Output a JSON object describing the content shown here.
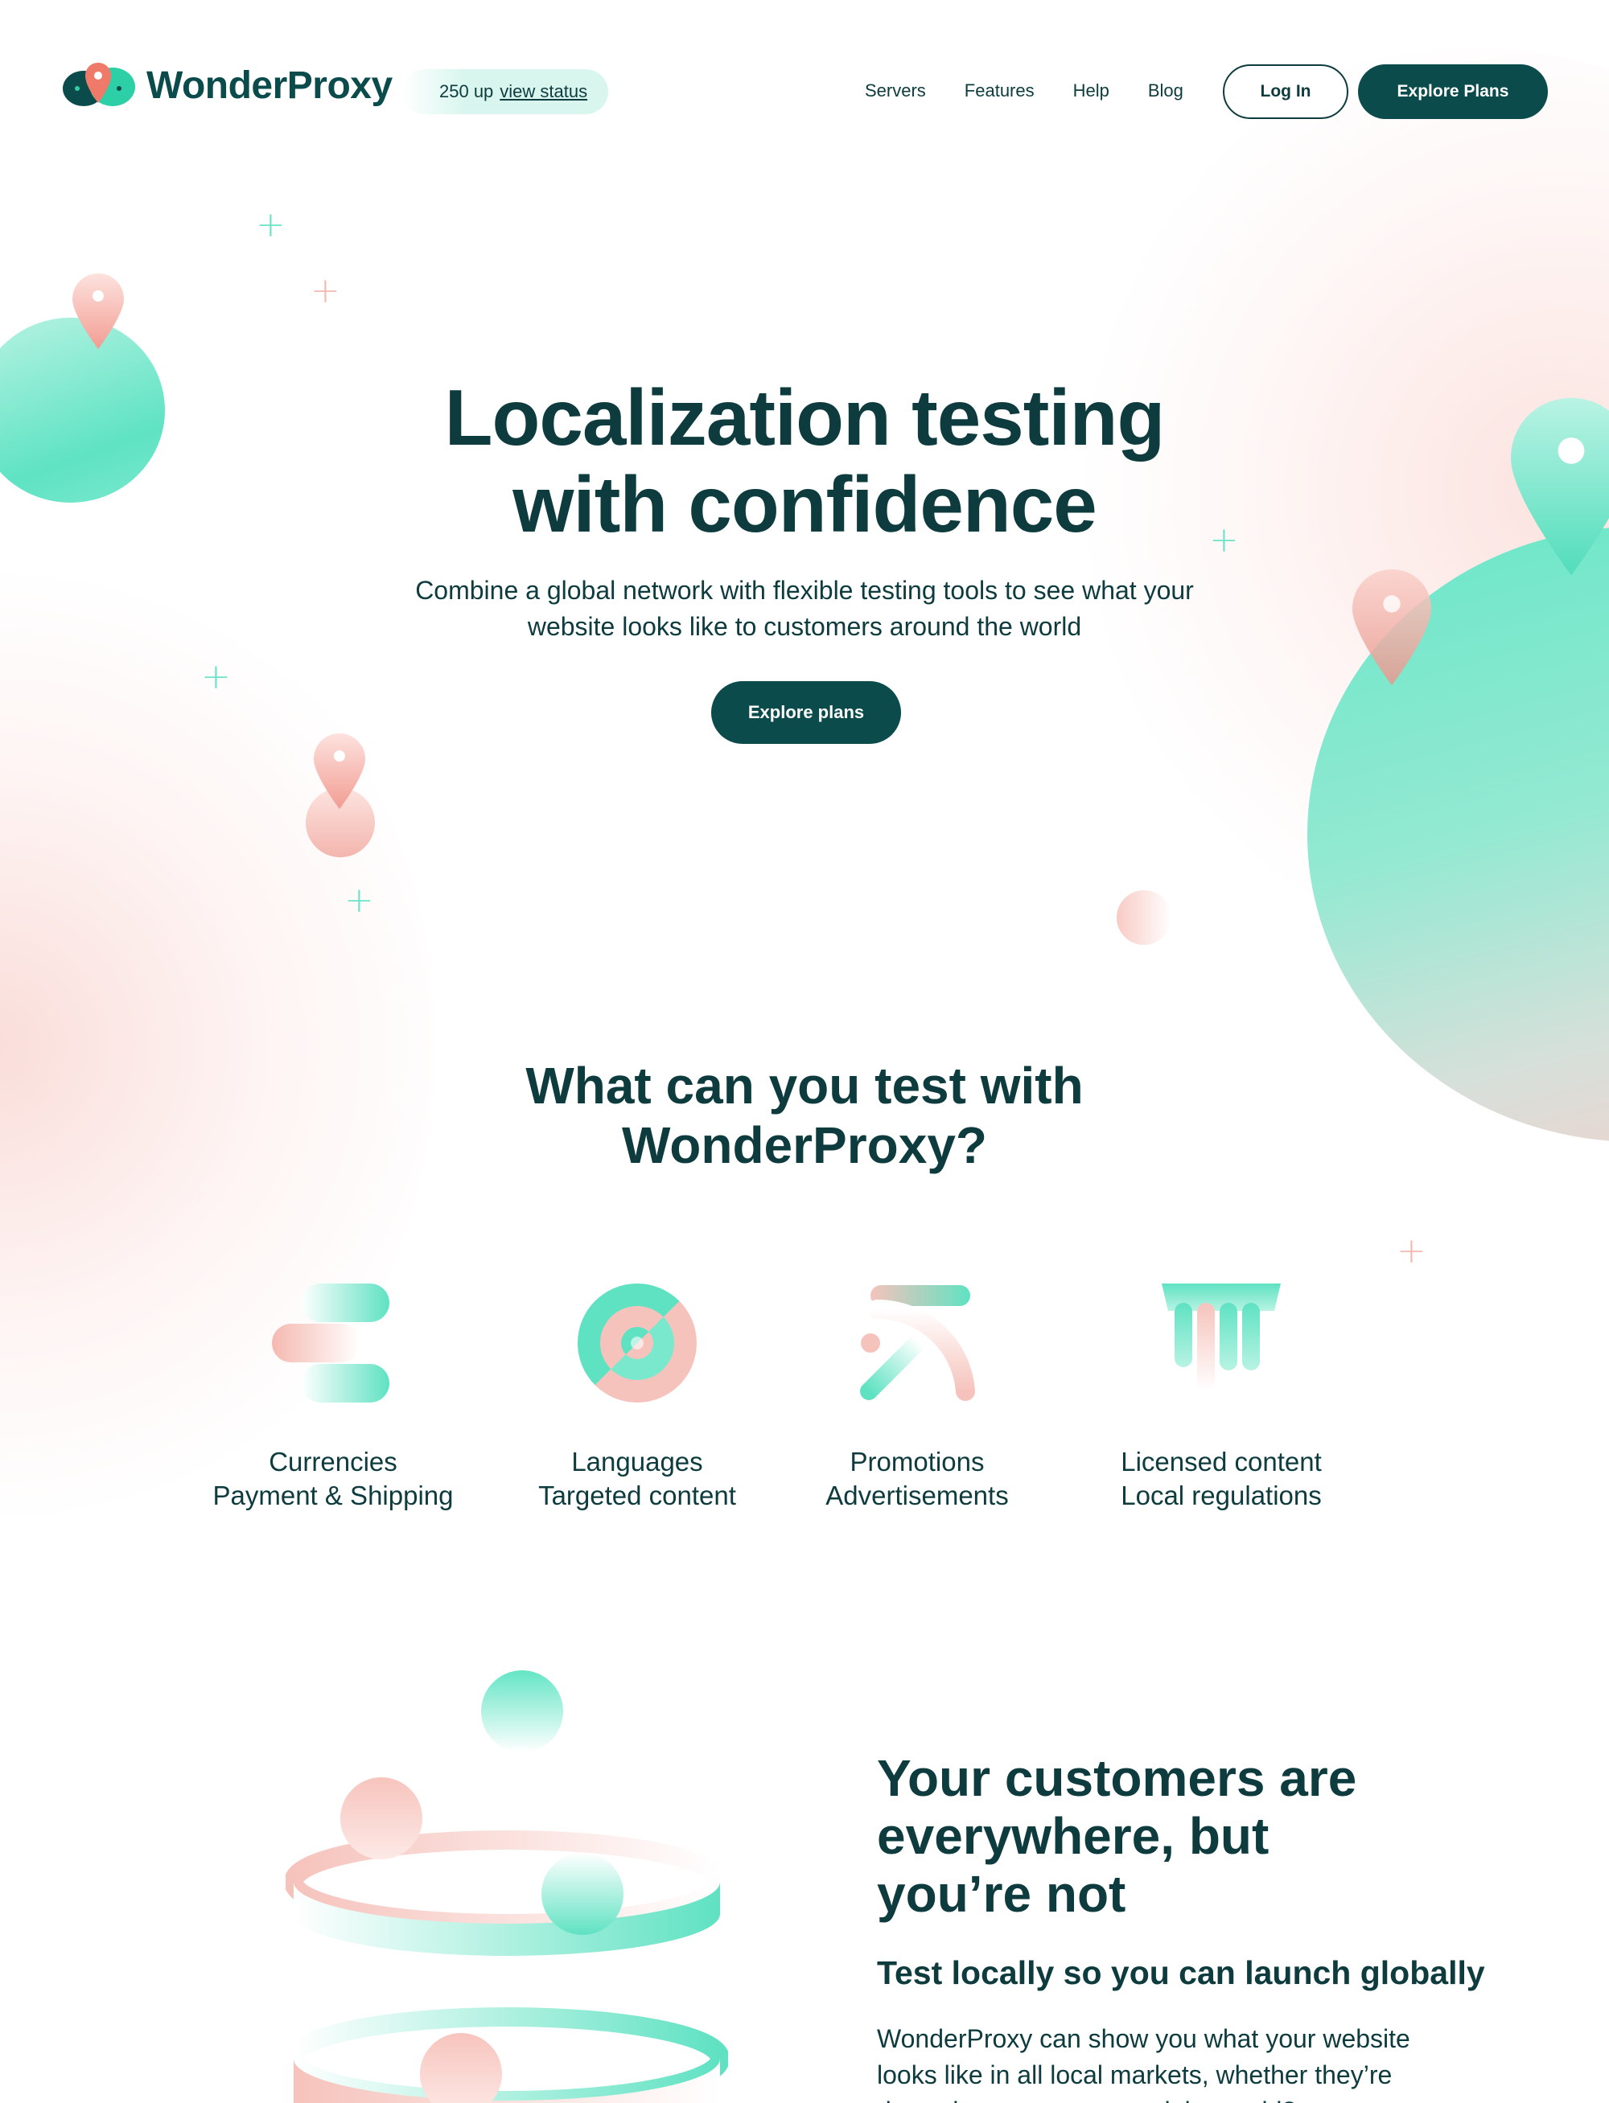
{
  "brand": {
    "name": "WonderProxy",
    "colors": {
      "primary": "#0b4b4c",
      "teal": "#5fe3c3",
      "pink": "#f5b9b1",
      "text": "#0d3b3e"
    }
  },
  "header": {
    "status": {
      "count_text": "250 up",
      "link_label": "view status"
    },
    "nav": [
      "Servers",
      "Features",
      "Help",
      "Blog"
    ],
    "login_label": "Log In",
    "plans_label": "Explore Plans"
  },
  "hero": {
    "title_line1": "Localization testing",
    "title_line2": "with confidence",
    "subtitle_line1": "Combine a global network with flexible testing tools to see what your",
    "subtitle_line2": "website looks like to customers around the world",
    "cta_label": "Explore plans"
  },
  "what_you_can_test": {
    "title_line1": "What can you test with",
    "title_line2": "WonderProxy?",
    "features": [
      {
        "icon": "currency-icon",
        "line1": "Currencies",
        "line2": "Payment & Shipping"
      },
      {
        "icon": "target-icon",
        "line1": "Languages",
        "line2": "Targeted content"
      },
      {
        "icon": "promotion-icon",
        "line1": "Promotions",
        "line2": "Advertisements"
      },
      {
        "icon": "license-icon",
        "line1": "Licensed content",
        "line2": "Local regulations"
      }
    ]
  },
  "customers": {
    "title_line1": "Your customers are",
    "title_line2": "everywhere, but",
    "title_line3": "you’re not",
    "subtitle": "Test locally so you can launch globally",
    "body_line1": "WonderProxy can show you what your website",
    "body_line2": "looks like in all local markets, whether they’re",
    "body_line3": "down the street or around the world?"
  }
}
